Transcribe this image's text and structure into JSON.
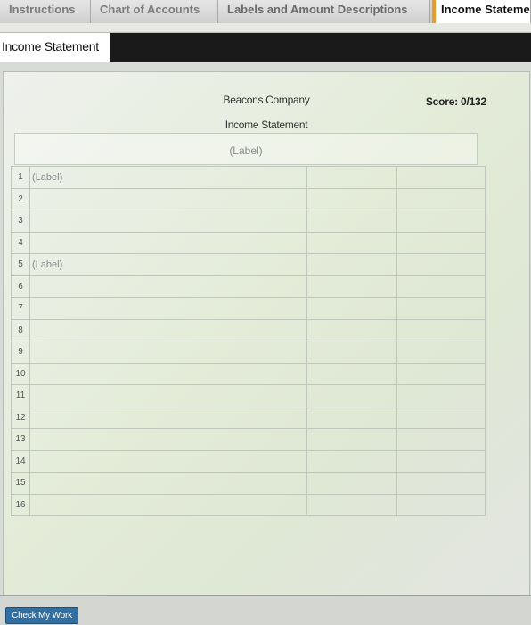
{
  "tabs": [
    {
      "label": "Instructions"
    },
    {
      "label": "Chart of Accounts"
    },
    {
      "label": "Labels and Amount Descriptions"
    },
    {
      "label": "Income Statement"
    }
  ],
  "section_title": "Income Statement",
  "statement": {
    "company": "Beacons Company",
    "title": "Income Statement",
    "period_label": "(Label)",
    "score_label": "Score:",
    "score_value": "0/132"
  },
  "rows": [
    {
      "num": "1",
      "label": "(Label)"
    },
    {
      "num": "2",
      "label": ""
    },
    {
      "num": "3",
      "label": ""
    },
    {
      "num": "4",
      "label": ""
    },
    {
      "num": "5",
      "label": "(Label)"
    },
    {
      "num": "6",
      "label": ""
    },
    {
      "num": "7",
      "label": ""
    },
    {
      "num": "8",
      "label": ""
    },
    {
      "num": "9",
      "label": ""
    },
    {
      "num": "10",
      "label": ""
    },
    {
      "num": "11",
      "label": ""
    },
    {
      "num": "12",
      "label": ""
    },
    {
      "num": "13",
      "label": ""
    },
    {
      "num": "14",
      "label": ""
    },
    {
      "num": "15",
      "label": ""
    },
    {
      "num": "16",
      "label": ""
    }
  ],
  "buttons": {
    "check_my_work": "Check My Work"
  },
  "colors": {
    "active_tab_accent": "#f09a1e",
    "button_bg": "#2f6fa3",
    "title_bar": "#1a1a1a"
  }
}
